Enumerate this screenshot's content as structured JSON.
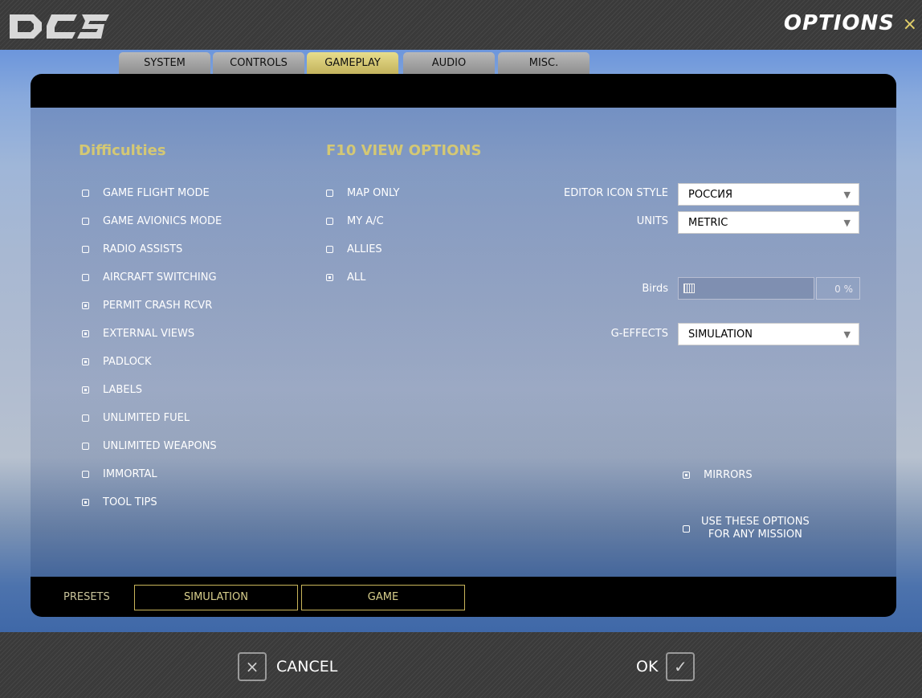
{
  "window": {
    "logo_text": "DCS",
    "title": "OPTIONS",
    "close_glyph": "×"
  },
  "tabs": [
    {
      "label": "SYSTEM",
      "active": false
    },
    {
      "label": "CONTROLS",
      "active": false
    },
    {
      "label": "GAMEPLAY",
      "active": true
    },
    {
      "label": "AUDIO",
      "active": false
    },
    {
      "label": "MISC.",
      "active": false
    }
  ],
  "difficulties": {
    "title": "Difficulties",
    "items": [
      {
        "label": "GAME FLIGHT MODE",
        "checked": false
      },
      {
        "label": "GAME AVIONICS MODE",
        "checked": false
      },
      {
        "label": "RADIO ASSISTS",
        "checked": false
      },
      {
        "label": "AIRCRAFT SWITCHING",
        "checked": false
      },
      {
        "label": "PERMIT CRASH RCVR",
        "checked": true
      },
      {
        "label": "EXTERNAL VIEWS",
        "checked": true
      },
      {
        "label": "PADLOCK",
        "checked": true
      },
      {
        "label": "LABELS",
        "checked": true
      },
      {
        "label": "UNLIMITED FUEL",
        "checked": false
      },
      {
        "label": "UNLIMITED WEAPONS",
        "checked": false
      },
      {
        "label": "IMMORTAL",
        "checked": false
      },
      {
        "label": "TOOL TIPS",
        "checked": true
      }
    ]
  },
  "f10": {
    "title": "F10 VIEW OPTIONS",
    "items": [
      {
        "label": "MAP ONLY",
        "checked": false
      },
      {
        "label": "MY A/C",
        "checked": false
      },
      {
        "label": "ALLIES",
        "checked": false
      },
      {
        "label": "ALL",
        "checked": true
      }
    ]
  },
  "settings": {
    "editor_icon_style": {
      "label": "EDITOR ICON STYLE",
      "value": "РОССИЯ"
    },
    "units": {
      "label": "UNITS",
      "value": "METRIC"
    },
    "birds": {
      "label": "Birds",
      "value": "0 %",
      "fraction": 0
    },
    "g_effects": {
      "label": "G-EFFECTS",
      "value": "SIMULATION"
    }
  },
  "mirrors": {
    "label": "MIRRORS",
    "checked": true
  },
  "use_options": {
    "line1": "USE THESE OPTIONS",
    "line2": "FOR ANY MISSION",
    "checked": false
  },
  "presets": {
    "label": "PRESETS",
    "simulation": "SIMULATION",
    "game": "GAME"
  },
  "actions": {
    "cancel_label": "CANCEL",
    "cancel_glyph": "×",
    "ok_label": "OK",
    "ok_glyph": "✓"
  }
}
